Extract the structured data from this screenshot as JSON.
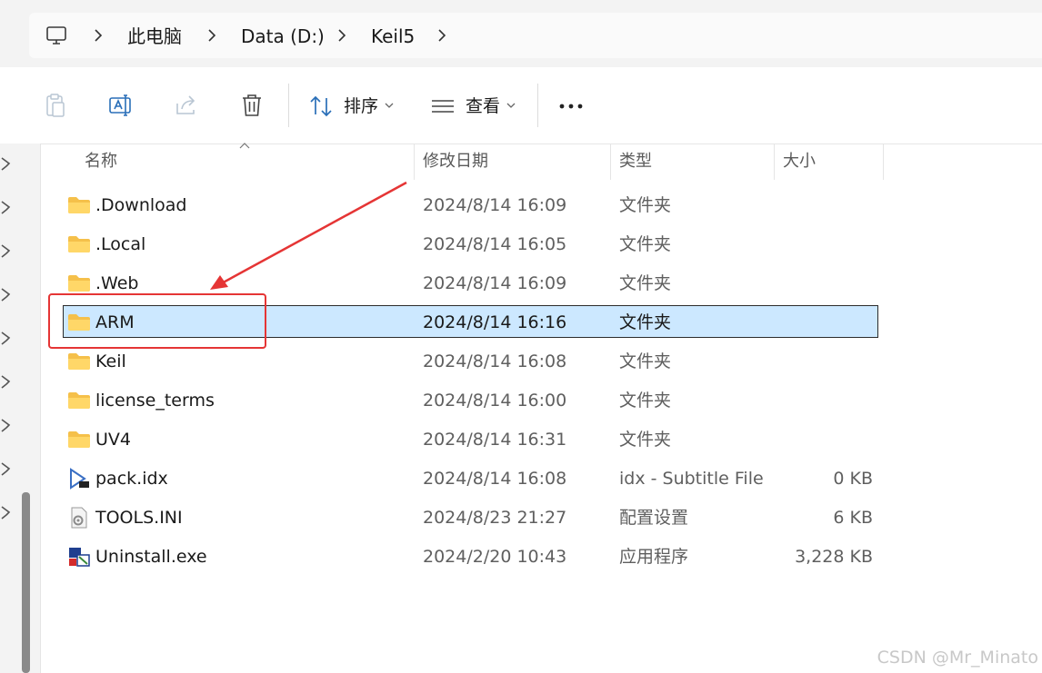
{
  "address": {
    "crumbs": [
      "此电脑",
      "Data (D:)",
      "Keil5"
    ]
  },
  "toolbar": {
    "sort_label": "排序",
    "view_label": "查看"
  },
  "columns": {
    "name": "名称",
    "date": "修改日期",
    "type": "类型",
    "size": "大小"
  },
  "files": [
    {
      "name": ".Download",
      "date": "2024/8/14 16:09",
      "type": "文件夹",
      "size": "",
      "icon": "folder-icon"
    },
    {
      "name": ".Local",
      "date": "2024/8/14 16:05",
      "type": "文件夹",
      "size": "",
      "icon": "folder-icon"
    },
    {
      "name": ".Web",
      "date": "2024/8/14 16:09",
      "type": "文件夹",
      "size": "",
      "icon": "folder-icon"
    },
    {
      "name": "ARM",
      "date": "2024/8/14 16:16",
      "type": "文件夹",
      "size": "",
      "icon": "folder-icon",
      "selected": true
    },
    {
      "name": "Keil",
      "date": "2024/8/14 16:08",
      "type": "文件夹",
      "size": "",
      "icon": "folder-icon"
    },
    {
      "name": "license_terms",
      "date": "2024/8/14 16:00",
      "type": "文件夹",
      "size": "",
      "icon": "folder-icon"
    },
    {
      "name": "UV4",
      "date": "2024/8/14 16:31",
      "type": "文件夹",
      "size": "",
      "icon": "folder-icon"
    },
    {
      "name": "pack.idx",
      "date": "2024/8/14 16:08",
      "type": "idx - Subtitle File",
      "size": "0 KB",
      "icon": "subtitle-file-icon"
    },
    {
      "name": "TOOLS.INI",
      "date": "2024/8/23 21:27",
      "type": "配置设置",
      "size": "6 KB",
      "icon": "ini-settings-icon"
    },
    {
      "name": "Uninstall.exe",
      "date": "2024/2/20 10:43",
      "type": "应用程序",
      "size": "3,228 KB",
      "icon": "uninstall-exe-icon"
    }
  ],
  "watermark": "CSDN @Mr_Minato",
  "colors": {
    "selection": "#cce8ff",
    "annotation_red": "#e53535",
    "folder": "#f5c04a"
  }
}
